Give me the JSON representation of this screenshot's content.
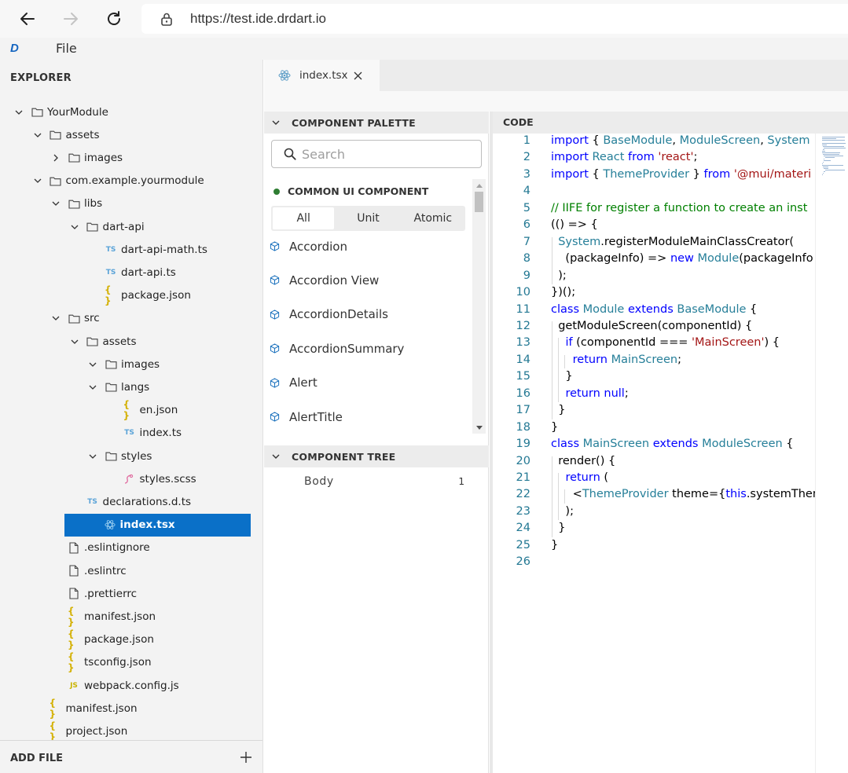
{
  "browser": {
    "url": "https://test.ide.drdart.io"
  },
  "app": {
    "logo": "D",
    "menu_file": "File"
  },
  "explorer": {
    "title": "EXPLORER",
    "add_file": "ADD FILE",
    "items": [
      {
        "label": "YourModule",
        "type": "folder",
        "depth": 0,
        "expanded": true
      },
      {
        "label": "assets",
        "type": "folder",
        "depth": 1,
        "expanded": true
      },
      {
        "label": "images",
        "type": "folder",
        "depth": 2,
        "expanded": false
      },
      {
        "label": "com.example.yourmodule",
        "type": "folder",
        "depth": 1,
        "expanded": true
      },
      {
        "label": "libs",
        "type": "folder",
        "depth": 2,
        "expanded": true
      },
      {
        "label": "dart-api",
        "type": "folder",
        "depth": 3,
        "expanded": true
      },
      {
        "label": "dart-api-math.ts",
        "type": "ts",
        "depth": 4
      },
      {
        "label": "dart-api.ts",
        "type": "ts",
        "depth": 4
      },
      {
        "label": "package.json",
        "type": "json",
        "depth": 4
      },
      {
        "label": "src",
        "type": "folder",
        "depth": 2,
        "expanded": true
      },
      {
        "label": "assets",
        "type": "folder",
        "depth": 3,
        "expanded": true
      },
      {
        "label": "images",
        "type": "folder",
        "depth": 4,
        "expanded": true
      },
      {
        "label": "langs",
        "type": "folder",
        "depth": 4,
        "expanded": true
      },
      {
        "label": "en.json",
        "type": "json",
        "depth": 5
      },
      {
        "label": "index.ts",
        "type": "ts",
        "depth": 5
      },
      {
        "label": "styles",
        "type": "folder",
        "depth": 4,
        "expanded": true
      },
      {
        "label": "styles.scss",
        "type": "scss",
        "depth": 5
      },
      {
        "label": "declarations.d.ts",
        "type": "ts",
        "depth": 3
      },
      {
        "label": "index.tsx",
        "type": "tsx",
        "depth": 3,
        "selected": true
      },
      {
        "label": ".eslintignore",
        "type": "file",
        "depth": 2
      },
      {
        "label": ".eslintrc",
        "type": "file",
        "depth": 2
      },
      {
        "label": ".prettierrc",
        "type": "file",
        "depth": 2
      },
      {
        "label": "manifest.json",
        "type": "json",
        "depth": 2
      },
      {
        "label": "package.json",
        "type": "json",
        "depth": 2
      },
      {
        "label": "tsconfig.json",
        "type": "json",
        "depth": 2
      },
      {
        "label": "webpack.config.js",
        "type": "js",
        "depth": 2
      },
      {
        "label": "manifest.json",
        "type": "json",
        "depth": 1
      },
      {
        "label": "project.json",
        "type": "json",
        "depth": 1
      }
    ]
  },
  "editor": {
    "tab_label": "index.tsx"
  },
  "palette": {
    "header": "COMPONENT PALETTE",
    "search_placeholder": "Search",
    "section_label": "COMMON UI COMPONENT",
    "segments": [
      "All",
      "Unit",
      "Atomic"
    ],
    "active_segment": "All",
    "components": [
      "Accordion",
      "Accordion View",
      "AccordionDetails",
      "AccordionSummary",
      "Alert",
      "AlertTitle"
    ],
    "tree_header": "COMPONENT TREE",
    "tree_body": "Body",
    "tree_body_count": "1"
  },
  "code": {
    "header": "CODE",
    "colors": {
      "keyword": "#0000ff",
      "type": "#267f99",
      "string": "#a31515",
      "comment": "#008000",
      "line_number": "#237893"
    },
    "lines": [
      {
        "n": "1",
        "text": "import { BaseModule, ModuleScreen, System"
      },
      {
        "n": "2",
        "text": "import React from 'react';"
      },
      {
        "n": "3",
        "text": "import { ThemeProvider } from '@mui/materi"
      },
      {
        "n": "4",
        "text": ""
      },
      {
        "n": "5",
        "text": "// IIFE for register a function to create an inst"
      },
      {
        "n": "6",
        "text": "(() => {"
      },
      {
        "n": "7",
        "text": "  System.registerModuleMainClassCreator("
      },
      {
        "n": "8",
        "text": "    (packageInfo) => new Module(packageInfo"
      },
      {
        "n": "9",
        "text": "  );"
      },
      {
        "n": "10",
        "text": "})();"
      },
      {
        "n": "11",
        "text": "class Module extends BaseModule {"
      },
      {
        "n": "12",
        "text": "  getModuleScreen(componentId) {"
      },
      {
        "n": "13",
        "text": "    if (componentId === 'MainScreen') {"
      },
      {
        "n": "14",
        "text": "      return MainScreen;"
      },
      {
        "n": "15",
        "text": "    }"
      },
      {
        "n": "16",
        "text": "    return null;"
      },
      {
        "n": "17",
        "text": "  }"
      },
      {
        "n": "18",
        "text": "}"
      },
      {
        "n": "19",
        "text": "class MainScreen extends ModuleScreen {"
      },
      {
        "n": "20",
        "text": "  render() {"
      },
      {
        "n": "21",
        "text": "    return ("
      },
      {
        "n": "22",
        "text": "      <ThemeProvider theme={this.systemThen"
      },
      {
        "n": "23",
        "text": "    );"
      },
      {
        "n": "24",
        "text": "  }"
      },
      {
        "n": "25",
        "text": "}"
      },
      {
        "n": "26",
        "text": ""
      }
    ]
  }
}
